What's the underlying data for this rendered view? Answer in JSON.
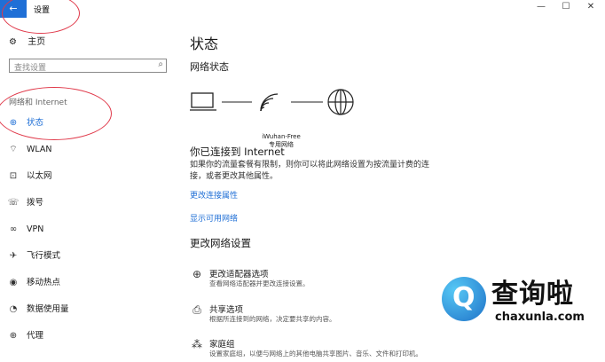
{
  "window": {
    "back_glyph": "←",
    "title": "设置",
    "min": "—",
    "max": "☐",
    "close": "✕"
  },
  "sidebar": {
    "home": "主页",
    "search_placeholder": "查找设置",
    "section": "网络和 Internet",
    "items": [
      {
        "label": "状态",
        "icon": "home-globe-icon",
        "active": true
      },
      {
        "label": "WLAN",
        "icon": "wifi-icon"
      },
      {
        "label": "以太网",
        "icon": "ethernet-icon"
      },
      {
        "label": "拨号",
        "icon": "dialup-icon"
      },
      {
        "label": "VPN",
        "icon": "vpn-icon"
      },
      {
        "label": "飞行模式",
        "icon": "airplane-icon"
      },
      {
        "label": "移动热点",
        "icon": "hotspot-icon"
      },
      {
        "label": "数据使用量",
        "icon": "data-usage-icon"
      },
      {
        "label": "代理",
        "icon": "globe-icon"
      }
    ]
  },
  "main": {
    "title": "状态",
    "network_status": "网络状态",
    "ssid": "iWuhan-Free",
    "network_type": "专用网络",
    "connected": "你已连接到 Internet",
    "connected_desc": "如果你的流量套餐有限制，则你可以将此网络设置为按流量计费的连接，或者更改其他属性。",
    "link_change_props": "更改连接属性",
    "link_show_networks": "显示可用网络",
    "change_settings": "更改网络设置",
    "options": [
      {
        "title": "更改适配器选项",
        "desc": "查看网络适配器并更改连接设置。",
        "icon": "adapter-icon"
      },
      {
        "title": "共享选项",
        "desc": "根据所连接到的网络，决定要共享的内容。",
        "icon": "sharing-icon"
      },
      {
        "title": "家庭组",
        "desc": "设置家庭组，以便与网络上的其他电脑共享图片、音乐、文件和打印机。",
        "icon": "homegroup-icon"
      }
    ]
  },
  "watermark": {
    "text": "查询啦",
    "url": "chaxunla.com",
    "logo": "Q"
  },
  "colors": {
    "accent": "#1f6fd6",
    "annotation": "#e0394a"
  }
}
